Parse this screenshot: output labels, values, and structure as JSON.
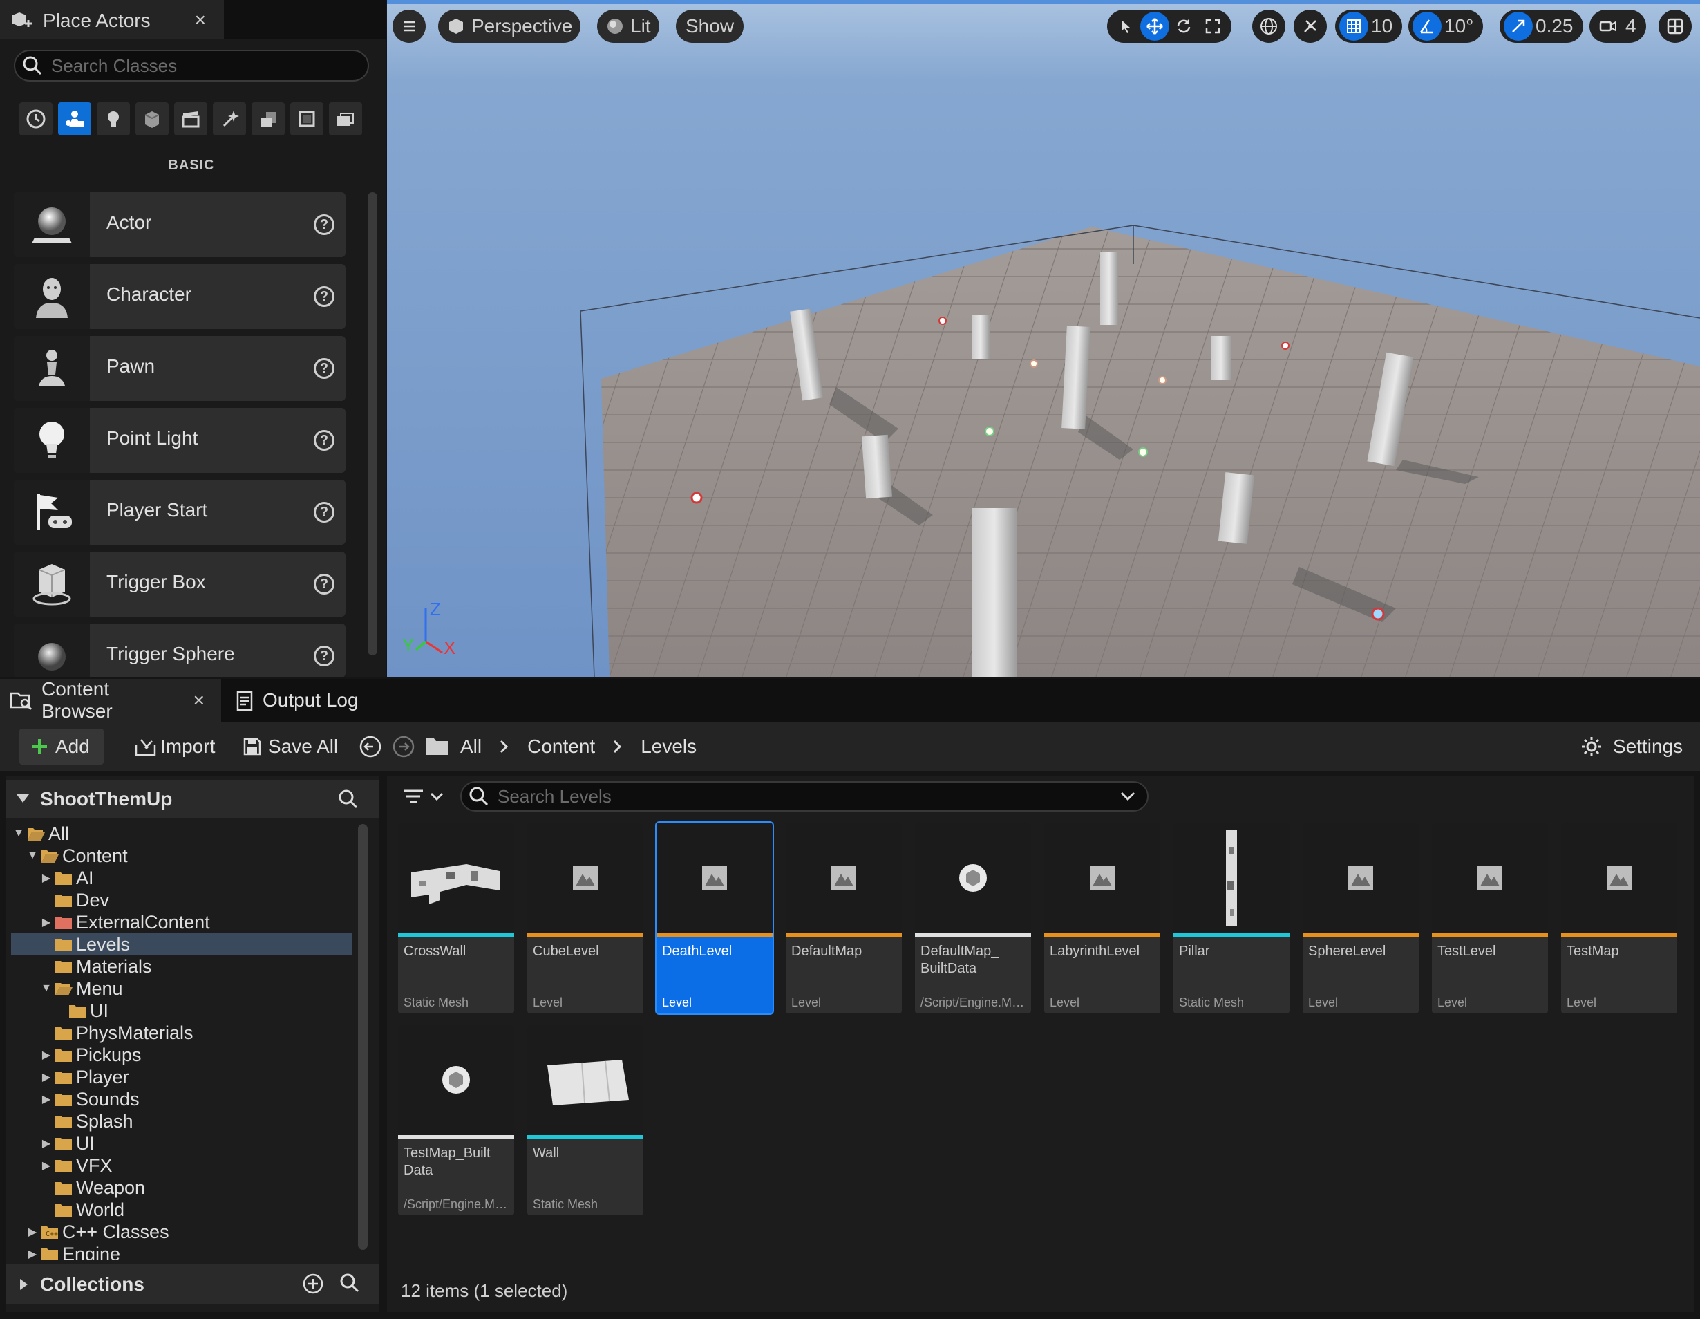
{
  "place_actors": {
    "tab_label": "Place Actors",
    "close": "×",
    "search_placeholder": "Search Classes",
    "categories": [
      "recent-icon",
      "basic-icon",
      "lights-icon",
      "shapes-icon",
      "cinematic-icon",
      "visual-effects-icon",
      "geometry-icon",
      "volumes-icon",
      "all-classes-icon"
    ],
    "section": "BASIC",
    "items": [
      {
        "label": "Actor",
        "icon": "actor-icon"
      },
      {
        "label": "Character",
        "icon": "character-icon"
      },
      {
        "label": "Pawn",
        "icon": "pawn-icon"
      },
      {
        "label": "Point Light",
        "icon": "point-light-icon"
      },
      {
        "label": "Player Start",
        "icon": "player-start-icon"
      },
      {
        "label": "Trigger Box",
        "icon": "trigger-box-icon"
      },
      {
        "label": "Trigger Sphere",
        "icon": "trigger-sphere-icon"
      }
    ],
    "help": "?"
  },
  "viewport": {
    "perspective": "Perspective",
    "lit": "Lit",
    "show": "Show",
    "grid_snap": "10",
    "rotation_snap": "10°",
    "scale_snap": "0.25",
    "camera_speed": "4",
    "axis": {
      "x": "X",
      "y": "Y",
      "z": "Z"
    }
  },
  "content_browser": {
    "tab_label": "Content Browser",
    "close": "×",
    "output_log": "Output Log",
    "toolbar": {
      "add": "Add",
      "import": "Import",
      "save_all": "Save All",
      "settings": "Settings"
    },
    "breadcrumb": [
      "All",
      "Content",
      "Levels"
    ],
    "project": "ShootThemUp",
    "collections": "Collections",
    "search_placeholder": "Search Levels",
    "tree": [
      {
        "label": "All",
        "depth": 0,
        "arrow": "down",
        "selected": false
      },
      {
        "label": "Content",
        "depth": 1,
        "arrow": "down",
        "selected": false
      },
      {
        "label": "AI",
        "depth": 2,
        "arrow": "right",
        "selected": false
      },
      {
        "label": "Dev",
        "depth": 2,
        "arrow": "",
        "selected": false
      },
      {
        "label": "ExternalContent",
        "depth": 2,
        "arrow": "right",
        "selected": false,
        "red": true
      },
      {
        "label": "Levels",
        "depth": 2,
        "arrow": "",
        "selected": true
      },
      {
        "label": "Materials",
        "depth": 2,
        "arrow": "",
        "selected": false
      },
      {
        "label": "Menu",
        "depth": 2,
        "arrow": "down",
        "selected": false
      },
      {
        "label": "UI",
        "depth": 3,
        "arrow": "",
        "selected": false
      },
      {
        "label": "PhysMaterials",
        "depth": 2,
        "arrow": "",
        "selected": false
      },
      {
        "label": "Pickups",
        "depth": 2,
        "arrow": "right",
        "selected": false
      },
      {
        "label": "Player",
        "depth": 2,
        "arrow": "right",
        "selected": false
      },
      {
        "label": "Sounds",
        "depth": 2,
        "arrow": "right",
        "selected": false
      },
      {
        "label": "Splash",
        "depth": 2,
        "arrow": "",
        "selected": false
      },
      {
        "label": "UI",
        "depth": 2,
        "arrow": "right",
        "selected": false
      },
      {
        "label": "VFX",
        "depth": 2,
        "arrow": "right",
        "selected": false
      },
      {
        "label": "Weapon",
        "depth": 2,
        "arrow": "",
        "selected": false
      },
      {
        "label": "World",
        "depth": 2,
        "arrow": "",
        "selected": false
      },
      {
        "label": "C++ Classes",
        "depth": 1,
        "arrow": "right",
        "selected": false,
        "cpp": true
      },
      {
        "label": "Engine",
        "depth": 1,
        "arrow": "right",
        "selected": false
      }
    ],
    "assets": [
      {
        "name": "CrossWall",
        "type": "Static Mesh",
        "kind": "mesh-cross",
        "stripe": "#1ec8d8"
      },
      {
        "name": "CubeLevel",
        "type": "Level",
        "kind": "level",
        "stripe": "#e8901c"
      },
      {
        "name": "DeathLevel",
        "type": "Level",
        "kind": "level",
        "stripe": "#e8901c",
        "selected": true
      },
      {
        "name": "DefaultMap",
        "type": "Level",
        "kind": "level",
        "stripe": "#e8901c"
      },
      {
        "name": "DefaultMap_ BuiltData",
        "type": "/Script/Engine.MapBuildDataRegistry",
        "kind": "data",
        "stripe": "#e0e0e0"
      },
      {
        "name": "LabyrinthLevel",
        "type": "Level",
        "kind": "level",
        "stripe": "#e8901c"
      },
      {
        "name": "Pillar",
        "type": "Static Mesh",
        "kind": "mesh-pillar",
        "stripe": "#1ec8d8"
      },
      {
        "name": "SphereLevel",
        "type": "Level",
        "kind": "level",
        "stripe": "#e8901c"
      },
      {
        "name": "TestLevel",
        "type": "Level",
        "kind": "level",
        "stripe": "#e8901c"
      },
      {
        "name": "TestMap",
        "type": "Level",
        "kind": "level",
        "stripe": "#e8901c"
      },
      {
        "name": "TestMap_Built Data",
        "type": "/Script/Engine.MapBuildDataRegistry",
        "kind": "data",
        "stripe": "#e0e0e0"
      },
      {
        "name": "Wall",
        "type": "Static Mesh",
        "kind": "mesh-wall",
        "stripe": "#1ec8d8"
      }
    ],
    "status": "12 items (1 selected)"
  },
  "colors": {
    "accent": "#0e6fd6",
    "level": "#e8901c",
    "mesh": "#1ec8d8",
    "folder": "#d9a54a"
  }
}
